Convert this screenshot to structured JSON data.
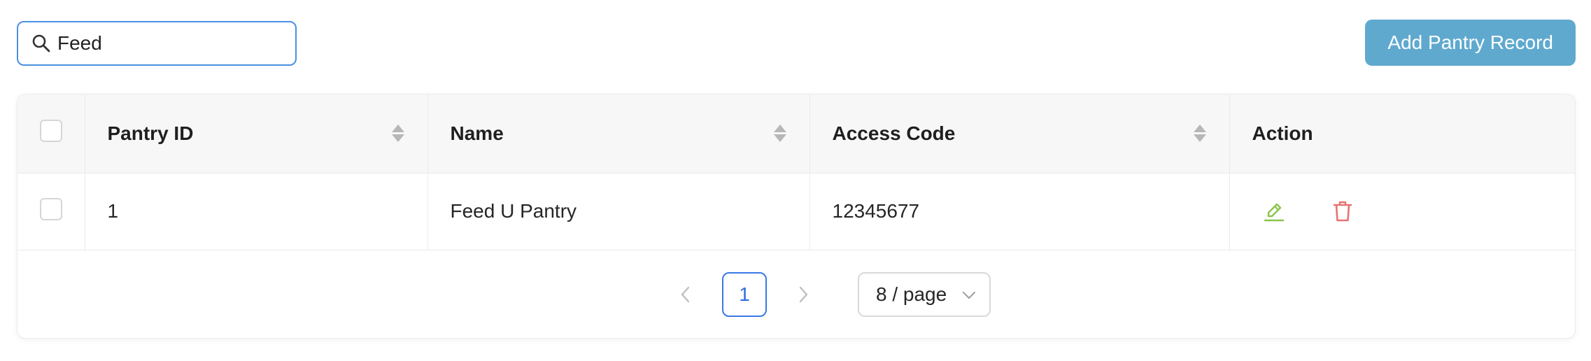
{
  "search": {
    "value": "Feed",
    "icon": "search-icon"
  },
  "toolbar": {
    "add_label": "Add Pantry Record",
    "add_color": "#5fa9cf"
  },
  "table": {
    "columns": [
      {
        "label": "Pantry ID",
        "sortable": true
      },
      {
        "label": "Name",
        "sortable": true
      },
      {
        "label": "Access Code",
        "sortable": true
      },
      {
        "label": "Action",
        "sortable": false
      }
    ],
    "rows": [
      {
        "pantry_id": "1",
        "name": "Feed U Pantry",
        "access_code": "12345677"
      }
    ],
    "action_icons": {
      "edit": {
        "icon": "pencil-icon",
        "color": "#8bc34a"
      },
      "delete": {
        "icon": "trash-icon",
        "color": "#e57373"
      }
    }
  },
  "pagination": {
    "current_page": "1",
    "page_size": "8 / page",
    "active_color": "#2f6fd9"
  }
}
